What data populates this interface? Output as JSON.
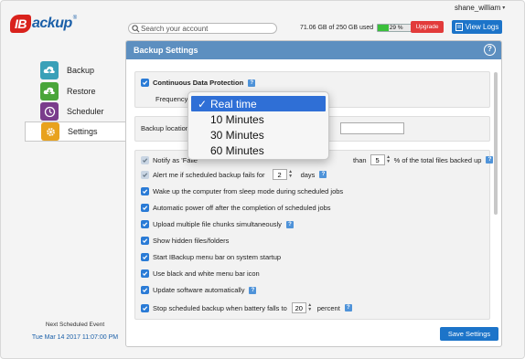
{
  "header": {
    "logo_badge": "IB",
    "logo_text": "ackup",
    "logo_reg": "®",
    "search_placeholder": "Search your account",
    "username": "shane_william",
    "usage_text": "71.06 GB of 250 GB used",
    "usage_percent": 29,
    "usage_label": "29 %",
    "upgrade_label": "Upgrade",
    "view_logs_label": "View Logs"
  },
  "sidebar": {
    "items": [
      {
        "label": "Backup",
        "icon": "cloud-upload-icon",
        "color": "#3aa0b8"
      },
      {
        "label": "Restore",
        "icon": "cloud-download-icon",
        "color": "#4aa53a"
      },
      {
        "label": "Scheduler",
        "icon": "clock-icon",
        "color": "#7a3d8c"
      },
      {
        "label": "Settings",
        "icon": "gear-icon",
        "color": "#e8a21d"
      }
    ],
    "next_event_label": "Next Scheduled Event",
    "next_event_date": "Tue Mar 14 2017 11:07:00 PM"
  },
  "panel": {
    "title": "Backup Settings",
    "cdp_label": "Continuous Data Protection",
    "frequency_label": "Frequency",
    "backup_location_label": "Backup location",
    "notify_prefix": "Notify as 'Faile",
    "notify_than": "than",
    "notify_value": "5",
    "notify_suffix": "% of the total files backed up",
    "alert_label": "Alert me if scheduled backup fails for",
    "alert_value": "2",
    "alert_suffix": "days",
    "options": [
      "Wake up the computer from sleep mode during scheduled jobs",
      "Automatic power off after the completion of scheduled jobs",
      "Upload multiple file chunks simultaneously",
      "Show hidden files/folders",
      "Start IBackup menu bar on system startup",
      "Use black and white menu bar icon",
      "Update software automatically"
    ],
    "battery_label": "Stop scheduled backup when battery falls to",
    "battery_value": "20",
    "battery_suffix": "percent",
    "save_label": "Save Settings"
  },
  "frequency_dropdown": {
    "check": "✓",
    "options": [
      "Real time",
      "10 Minutes",
      "30 Minutes",
      "60 Minutes"
    ],
    "selected_index": 0
  },
  "colors": {
    "accent": "#1c74c9",
    "panel_header": "#5d8fc0",
    "upgrade": "#e23b3b",
    "usage_fill": "#3bbf3b"
  }
}
